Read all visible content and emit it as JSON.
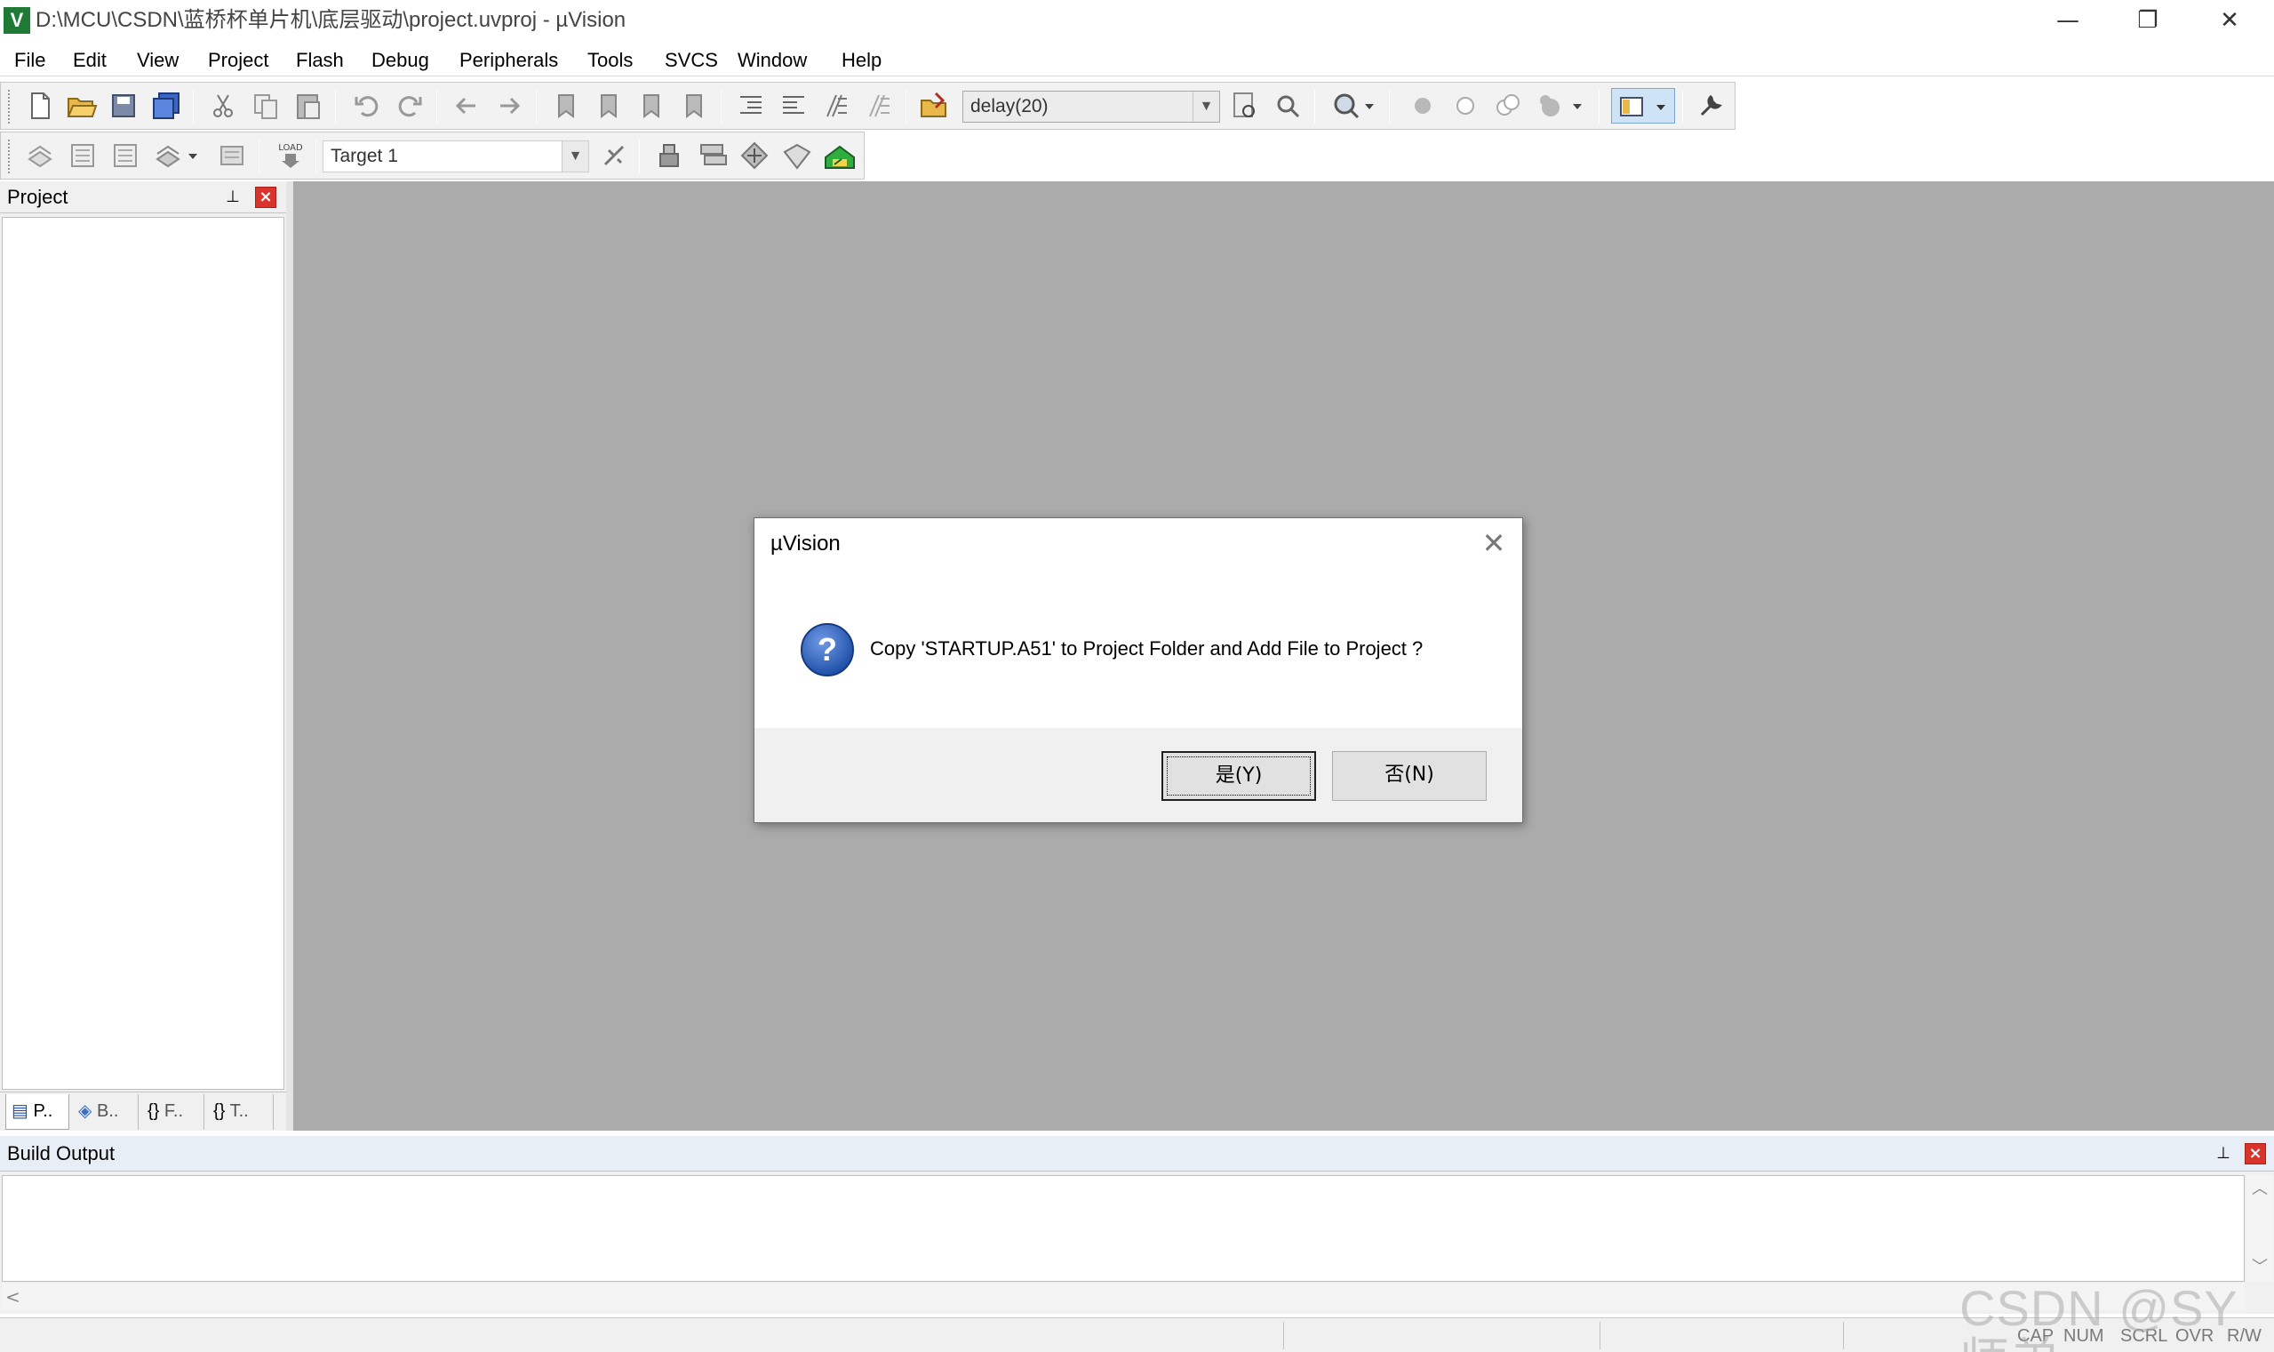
{
  "window": {
    "logo": "V",
    "title": "D:\\MCU\\CSDN\\蓝桥杯单片机\\底层驱动\\project.uvproj - µVision",
    "min_glyph": "—",
    "max_glyph": "❐",
    "close_glyph": "✕"
  },
  "menu": [
    "File",
    "Edit",
    "View",
    "Project",
    "Flash",
    "Debug",
    "Peripherals",
    "Tools",
    "SVCS",
    "Window",
    "Help"
  ],
  "toolbar": {
    "find_value": "delay(20)",
    "target_value": "Target 1",
    "arrow": "▼"
  },
  "project_panel": {
    "title": "Project",
    "pin": "⊥",
    "close": "×",
    "tabs": [
      "P..",
      "B..",
      "F..",
      "T.."
    ],
    "tab_icons": [
      "▤",
      "◈",
      "{}",
      "{}"
    ]
  },
  "build_output": {
    "title": "Build Output",
    "pin": "⊥",
    "close": "×",
    "scroll_up": "︿",
    "scroll_down": "﹀",
    "scroll_left": "<"
  },
  "status": {
    "indicators": [
      "CAP",
      "NUM",
      "SCRL",
      "OVR",
      "R/W"
    ],
    "watermark": "CSDN @SY师弟"
  },
  "dialog": {
    "title": "µVision",
    "close": "✕",
    "message": "Copy 'STARTUP.A51' to Project Folder and Add File to Project ?",
    "yes_label": "是(Y)",
    "no_label": "否(N)",
    "icon_glyph": "?"
  },
  "colors": {
    "editor_bg": "#ababab",
    "close_red": "#d9342b",
    "question_blue": "#1f4fa8"
  }
}
